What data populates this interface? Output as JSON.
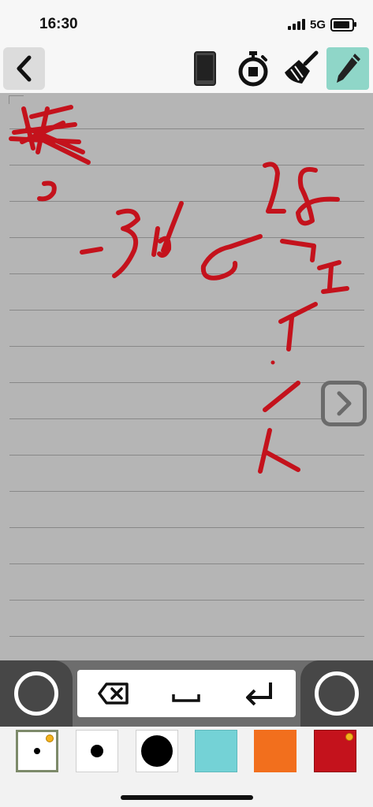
{
  "status": {
    "time": "16:30",
    "network": "5G"
  },
  "toolbar": {
    "back_icon": "chevron-left-icon",
    "tools": [
      {
        "name": "phone-icon",
        "active": false
      },
      {
        "name": "stopwatch-icon",
        "active": false
      },
      {
        "name": "broom-icon",
        "active": false
      },
      {
        "name": "pencil-icon",
        "active": true
      }
    ]
  },
  "canvas": {
    "background": "#b5b5b5",
    "ink_color": "#c4121c",
    "next_page_icon": "chevron-right-icon"
  },
  "keys": {
    "backspace_icon": "backspace-icon",
    "space_icon": "space-icon",
    "enter_icon": "enter-icon"
  },
  "palette": {
    "pen_sizes": [
      "small",
      "medium",
      "large"
    ],
    "colors": [
      "#74d2d6",
      "#f26f1d",
      "#c4121c"
    ],
    "selected_pen_size": "small",
    "selected_color": "#c4121c"
  }
}
